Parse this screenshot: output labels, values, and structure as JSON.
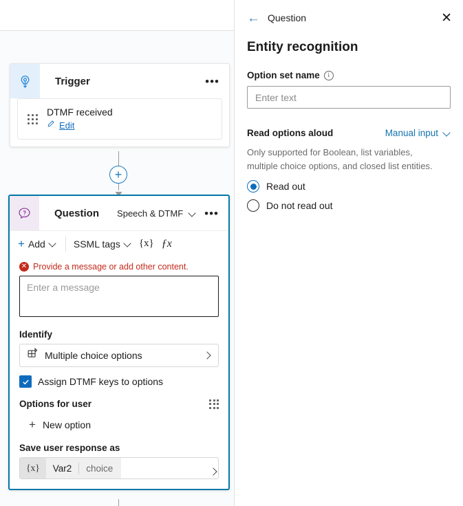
{
  "canvas": {
    "trigger_node": {
      "title": "Trigger",
      "icon": "broadcast-icon",
      "more_label": "•••",
      "inner": {
        "title": "DTMF received",
        "edit_label": "Edit",
        "edit_icon": "pencil-icon",
        "grip_icon": "drag-grip-icon"
      }
    },
    "add_node_button": {
      "label": "+",
      "icon": "plus-icon"
    },
    "question_node": {
      "title": "Question",
      "icon": "question-bubble-icon",
      "mode_label": "Speech & DTMF",
      "more_label": "•••",
      "toolbar": {
        "add_label": "Add",
        "ssml_label": "SSML tags",
        "variable_label": "{x}",
        "formula_label": "ƒx"
      },
      "error": {
        "icon": "error-circle-icon",
        "text": "Provide a message or add other content."
      },
      "message_placeholder": "Enter a message",
      "identify_label": "Identify",
      "identify_value": "Multiple choice options",
      "identify_icon": "multiple-choice-icon",
      "assign_dtmf_label": "Assign DTMF keys to options",
      "assign_dtmf_checked": true,
      "options_for_user_label": "Options for user",
      "keypad_icon": "dtmf-keypad-icon",
      "new_option_label": "New option",
      "save_response_label": "Save user response as",
      "variable": {
        "token": "{x}",
        "name": "Var2",
        "type": "choice"
      }
    }
  },
  "panel": {
    "back_icon": "back-arrow-icon",
    "breadcrumb": "Question",
    "close_icon": "close-icon",
    "title": "Entity recognition",
    "option_set_name_label": "Option set name",
    "info_icon": "info-icon",
    "option_set_name_placeholder": "Enter text",
    "read_options_aloud_label": "Read options aloud",
    "manual_input_label": "Manual input",
    "help_text": "Only supported for Boolean, list variables, multiple choice options, and closed list entities.",
    "radios": [
      {
        "label": "Read out",
        "selected": true
      },
      {
        "label": "Do not read out",
        "selected": false
      }
    ]
  },
  "colors": {
    "accent_blue": "#0f6cbd",
    "card_border_teal": "#0078a8",
    "error_red": "#c42b1c",
    "trigger_badge": "#e3f0fb",
    "question_badge": "#f1e9f3",
    "link_blue": "#1573ad"
  }
}
